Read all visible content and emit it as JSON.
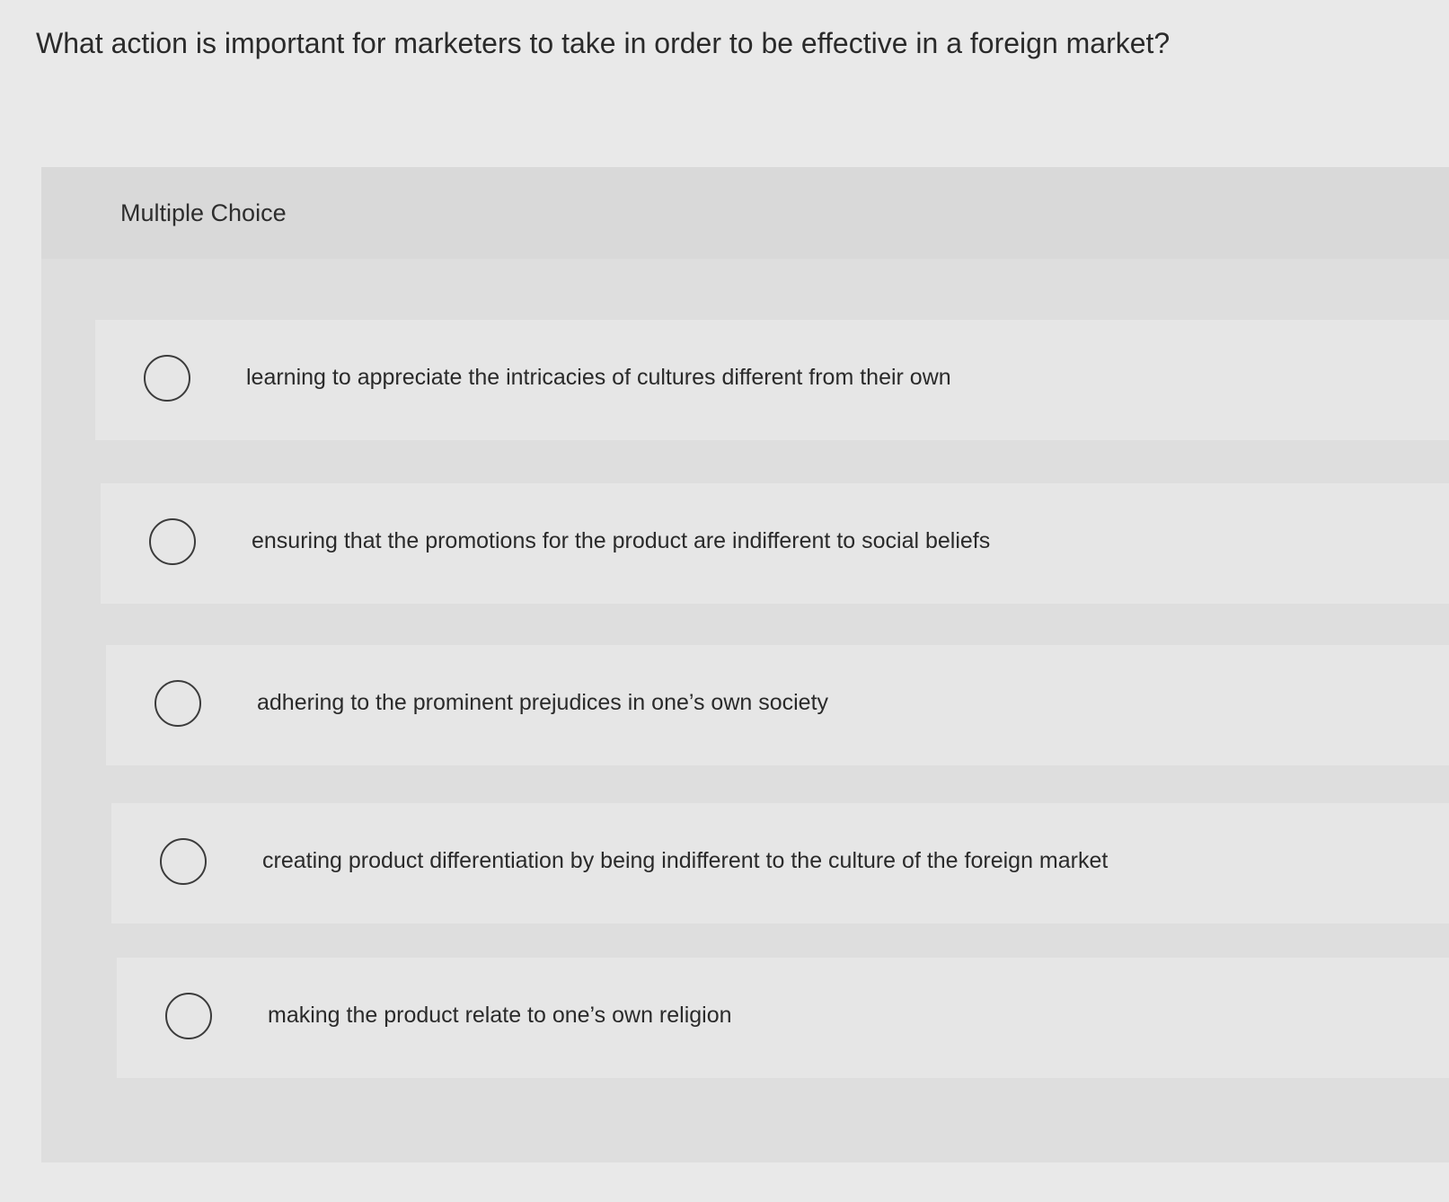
{
  "question": "What action is important for marketers to take in order to be effective in a foreign market?",
  "panel": {
    "title": "Multiple Choice",
    "options": [
      {
        "label": "learning to appreciate the intricacies of cultures different from their own",
        "selected": false
      },
      {
        "label": "ensuring that the promotions for the product are indifferent to social beliefs",
        "selected": false
      },
      {
        "label": "adhering to the prominent prejudices in one’s own society",
        "selected": false
      },
      {
        "label": "creating product differentiation by being indifferent to the culture of the foreign market",
        "selected": false
      },
      {
        "label": "making the product relate to one’s own religion",
        "selected": false
      }
    ]
  }
}
